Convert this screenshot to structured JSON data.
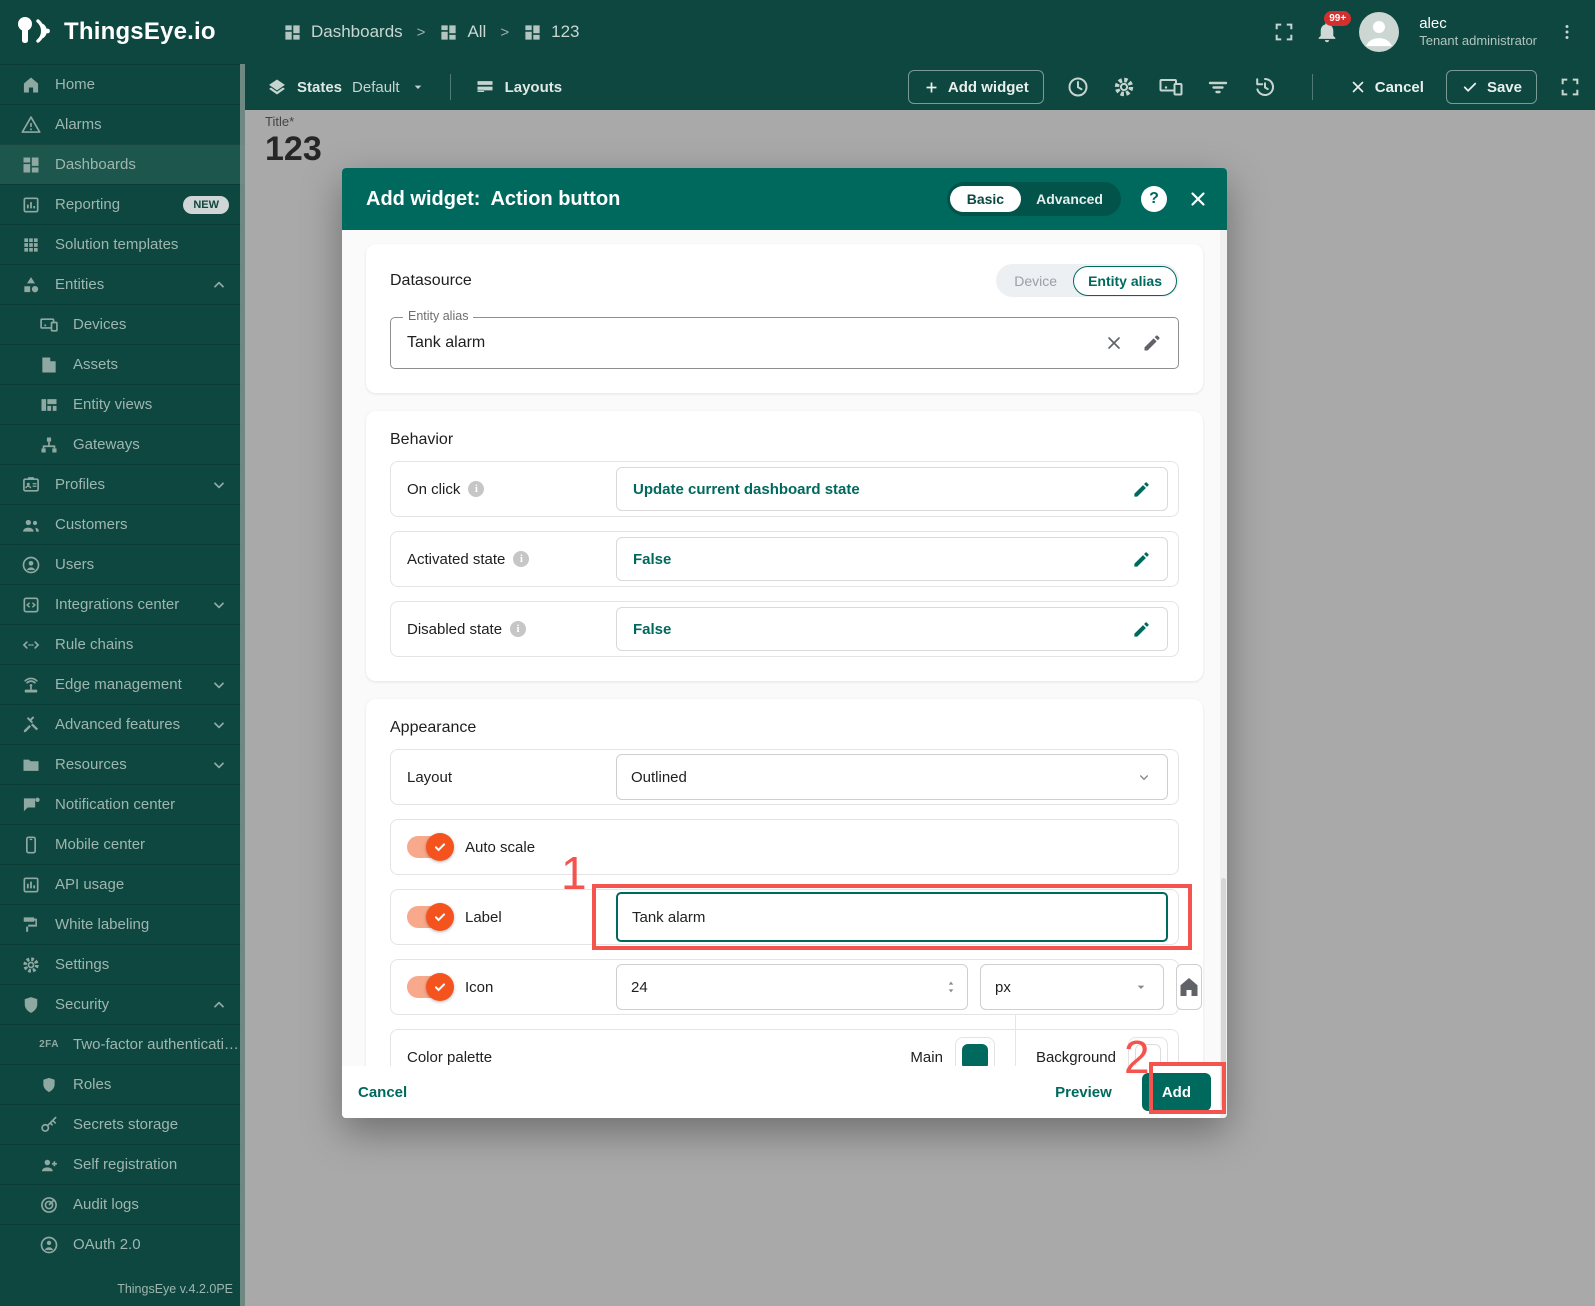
{
  "app": {
    "logo_text": "ThingsEye.io",
    "version": "ThingsEye v.4.2.0PE"
  },
  "header": {
    "breadcrumbs": [
      {
        "label": "Dashboards"
      },
      {
        "label": "All"
      },
      {
        "label": "123"
      }
    ],
    "user": {
      "name": "alec",
      "role": "Tenant administrator",
      "notification_badge": "99+"
    }
  },
  "toolbar": {
    "states_label": "States",
    "states_value": "Default",
    "layouts_label": "Layouts",
    "add_widget_label": "Add widget",
    "cancel_label": "Cancel",
    "save_label": "Save"
  },
  "canvas": {
    "title_label": "Title*",
    "title_value": "123"
  },
  "sidebar": {
    "items": [
      {
        "icon": "home",
        "label": "Home"
      },
      {
        "icon": "alarm",
        "label": "Alarms"
      },
      {
        "icon": "dashboard",
        "label": "Dashboards",
        "active": true
      },
      {
        "icon": "report",
        "label": "Reporting",
        "badge": "NEW"
      },
      {
        "icon": "apps",
        "label": "Solution templates"
      },
      {
        "icon": "category",
        "label": "Entities",
        "chevron": "up"
      },
      {
        "icon": "devices",
        "label": "Devices",
        "child": true
      },
      {
        "icon": "assets",
        "label": "Assets",
        "child": true
      },
      {
        "icon": "views",
        "label": "Entity views",
        "child": true
      },
      {
        "icon": "lan",
        "label": "Gateways",
        "child": true
      },
      {
        "icon": "badge",
        "label": "Profiles",
        "chevron": "down"
      },
      {
        "icon": "people",
        "label": "Customers"
      },
      {
        "icon": "person",
        "label": "Users"
      },
      {
        "icon": "integration",
        "label": "Integrations center",
        "chevron": "down"
      },
      {
        "icon": "rule",
        "label": "Rule chains"
      },
      {
        "icon": "edge",
        "label": "Edge management",
        "chevron": "down"
      },
      {
        "icon": "tools",
        "label": "Advanced features",
        "chevron": "down"
      },
      {
        "icon": "folder",
        "label": "Resources",
        "chevron": "down"
      },
      {
        "icon": "notify",
        "label": "Notification center"
      },
      {
        "icon": "phone",
        "label": "Mobile center"
      },
      {
        "icon": "api",
        "label": "API usage"
      },
      {
        "icon": "paint",
        "label": "White labeling"
      },
      {
        "icon": "gear",
        "label": "Settings"
      },
      {
        "icon": "shield",
        "label": "Security",
        "chevron": "up"
      },
      {
        "icon": "twofa",
        "label": "Two-factor authenticati…",
        "child": true
      },
      {
        "icon": "roles",
        "label": "Roles",
        "child": true
      },
      {
        "icon": "key",
        "label": "Secrets storage",
        "child": true
      },
      {
        "icon": "personadd",
        "label": "Self registration",
        "child": true
      },
      {
        "icon": "audit",
        "label": "Audit logs",
        "child": true
      },
      {
        "icon": "oauth",
        "label": "OAuth 2.0",
        "child": true
      }
    ]
  },
  "modal": {
    "title_prefix": "Add widget:",
    "title_widget": "Action button",
    "mode_toggle": {
      "basic": "Basic",
      "advanced": "Advanced"
    },
    "datasource": {
      "heading": "Datasource",
      "toggle": {
        "device": "Device",
        "entity_alias": "Entity alias"
      },
      "field_label": "Entity alias",
      "field_value": "Tank alarm"
    },
    "behavior": {
      "heading": "Behavior",
      "rows": [
        {
          "label": "On click",
          "value": "Update current dashboard state"
        },
        {
          "label": "Activated state",
          "value": "False"
        },
        {
          "label": "Disabled state",
          "value": "False"
        }
      ]
    },
    "appearance": {
      "heading": "Appearance",
      "layout_label": "Layout",
      "layout_value": "Outlined",
      "auto_scale_label": "Auto scale",
      "label_row_label": "Label",
      "label_value": "Tank alarm",
      "icon_row_label": "Icon",
      "icon_size": "24",
      "icon_unit": "px",
      "color_palette_label": "Color palette",
      "main_label": "Main",
      "background_label": "Background"
    },
    "footer": {
      "cancel": "Cancel",
      "preview": "Preview",
      "add": "Add"
    },
    "annotations": {
      "step1": "1",
      "step2": "2"
    }
  },
  "colors": {
    "accent_teal": "#00695e",
    "sidebar_dark": "#0d473f",
    "toggle_orange": "#f4531d",
    "annotation_red": "#f4544d",
    "badge_red": "#d32f2f",
    "main_swatch": "#00695e",
    "background_swatch": "#ffffff"
  }
}
